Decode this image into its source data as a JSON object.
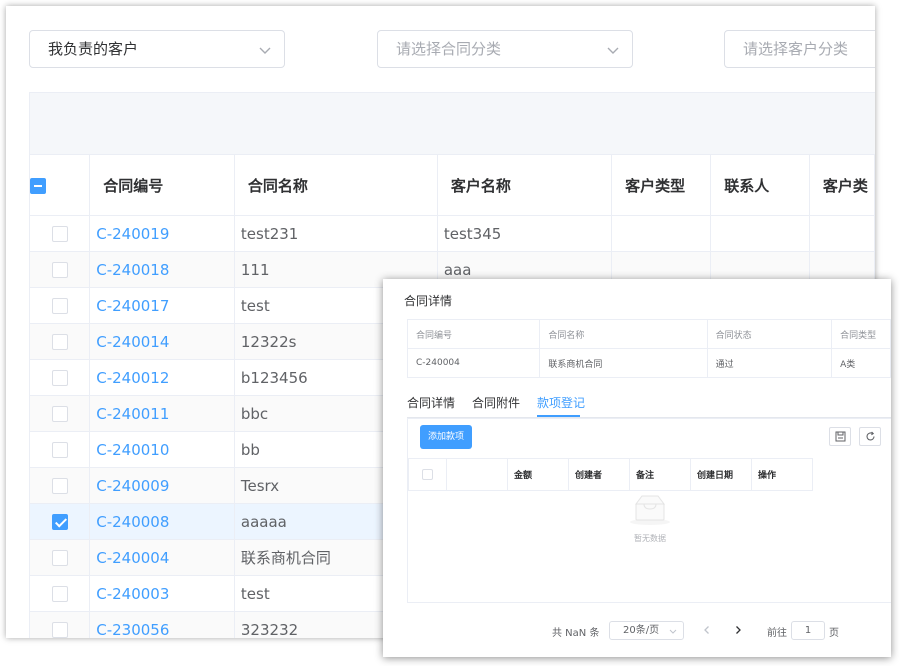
{
  "filters": {
    "owner": "我负责的客户",
    "contract_category_placeholder": "请选择合同分类",
    "customer_category_placeholder": "请选择客户分类"
  },
  "table": {
    "headers": [
      "合同编号",
      "合同名称",
      "客户名称",
      "客户类型",
      "联系人",
      "客户类"
    ],
    "rows": [
      {
        "code": "C-240019",
        "name": "test231",
        "customer": "test345",
        "checked": false
      },
      {
        "code": "C-240018",
        "name": "111",
        "customer": "aaa",
        "checked": false
      },
      {
        "code": "C-240017",
        "name": "test",
        "customer": "",
        "checked": false
      },
      {
        "code": "C-240014",
        "name": "12322s",
        "customer": "",
        "checked": false
      },
      {
        "code": "C-240012",
        "name": "b123456",
        "customer": "",
        "checked": false
      },
      {
        "code": "C-240011",
        "name": "bbc",
        "customer": "",
        "checked": false
      },
      {
        "code": "C-240010",
        "name": "bb",
        "customer": "",
        "checked": false
      },
      {
        "code": "C-240009",
        "name": "Tesrx",
        "customer": "",
        "checked": false
      },
      {
        "code": "C-240008",
        "name": "aaaaa",
        "customer": "",
        "checked": true
      },
      {
        "code": "C-240004",
        "name": "联系商机合同",
        "customer": "",
        "checked": false
      },
      {
        "code": "C-240003",
        "name": "test",
        "customer": "",
        "checked": false
      },
      {
        "code": "C-230056",
        "name": "323232",
        "customer": "",
        "checked": false
      }
    ]
  },
  "dialog": {
    "title": "合同详情",
    "info_headers": [
      "合同编号",
      "合同名称",
      "合同状态",
      "合同类型"
    ],
    "info_values": [
      "C-240004",
      "联系商机合同",
      "通过",
      "A类"
    ],
    "tabs": [
      "合同详情",
      "合同附件",
      "款项登记"
    ],
    "active_tab": "款项登记",
    "add_button": "添加款项",
    "item_headers": [
      "金额",
      "创建者",
      "备注",
      "创建日期",
      "操作"
    ],
    "empty_text": "暂无数据",
    "pager": {
      "total": "共 NaN 条",
      "page_size": "20条/页",
      "goto_label": "前往",
      "page_value": "1",
      "page_unit": "页"
    }
  }
}
